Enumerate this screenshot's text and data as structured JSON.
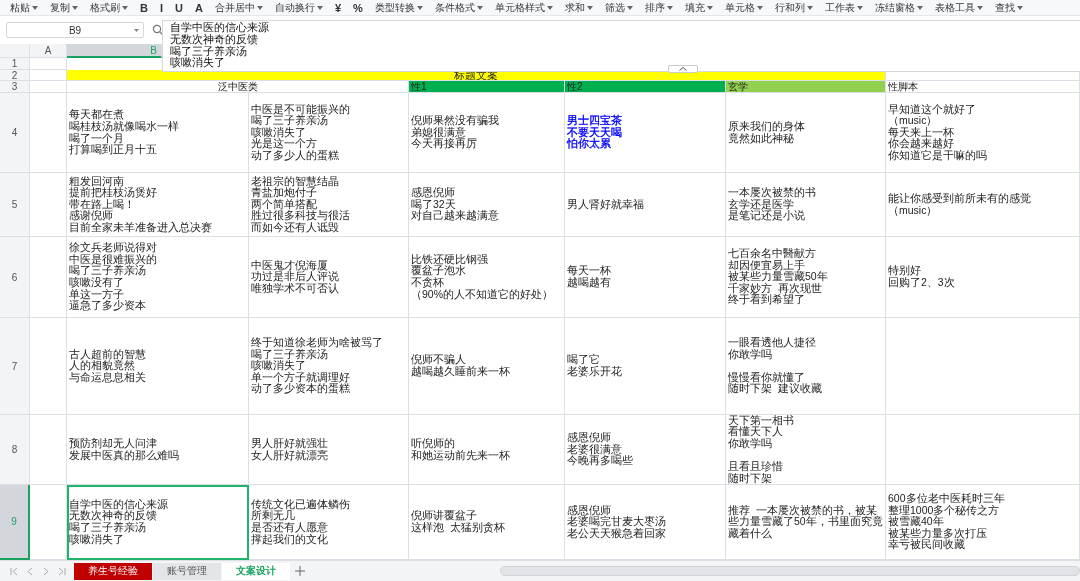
{
  "toolbar": {
    "items": [
      {
        "label": "粘贴",
        "kind": "text"
      },
      {
        "label": "复制",
        "kind": "text"
      },
      {
        "label": "格式刷",
        "kind": "text"
      },
      {
        "label": "B",
        "kind": "glyph"
      },
      {
        "label": "I",
        "kind": "glyph"
      },
      {
        "label": "U",
        "kind": "glyph"
      },
      {
        "label": "A",
        "kind": "glyph"
      },
      {
        "label": "合并居中",
        "kind": "text"
      },
      {
        "label": "自动换行",
        "kind": "text"
      },
      {
        "label": "¥",
        "kind": "glyph"
      },
      {
        "label": "%",
        "kind": "glyph"
      },
      {
        "label": "类型转换",
        "kind": "text"
      },
      {
        "label": "条件格式",
        "kind": "text"
      },
      {
        "label": "单元格样式",
        "kind": "text"
      },
      {
        "label": "求和",
        "kind": "text"
      },
      {
        "label": "筛选",
        "kind": "text"
      },
      {
        "label": "排序",
        "kind": "text"
      },
      {
        "label": "填充",
        "kind": "text"
      },
      {
        "label": "单元格",
        "kind": "text"
      },
      {
        "label": "行和列",
        "kind": "text"
      },
      {
        "label": "工作表",
        "kind": "text"
      },
      {
        "label": "冻结窗格",
        "kind": "text"
      },
      {
        "label": "表格工具",
        "kind": "text"
      },
      {
        "label": "查找",
        "kind": "text"
      }
    ]
  },
  "formula_bar": {
    "cell_ref": "B9",
    "lines": [
      "自学中医的信心来源",
      "无数次神奇的反馈",
      "喝了三子养亲汤",
      "咳嗽消失了"
    ]
  },
  "column_headers": [
    {
      "label": "A",
      "selected": false
    },
    {
      "label": "B",
      "selected": true
    }
  ],
  "blank_row": {
    "number": "1"
  },
  "title_row": {
    "number": "2",
    "text": "标题文案"
  },
  "header_row": {
    "number": "3",
    "cells": [
      {
        "text": "泛中医类",
        "color": "#ffffff"
      },
      {
        "text": "性1",
        "color": "#00b050"
      },
      {
        "text": "性2",
        "color": "#00b050"
      },
      {
        "text": "玄学",
        "color": "#92d050"
      },
      {
        "text": "性脚本",
        "color": "#ffffff"
      }
    ]
  },
  "rows": [
    {
      "number": "4",
      "selected": false,
      "cells": [
        {
          "groups": [
            [
              "每天都在煮",
              "喝桂枝汤就像喝水一样",
              "喝了一个月",
              "打算喝到正月十五"
            ]
          ],
          "selected": false
        },
        {
          "groups": [
            [
              "中医是不可能振兴的",
              "喝了三子养亲汤",
              "咳嗽消失了",
              "光是这一个方",
              "动了多少人的蛋糕"
            ]
          ],
          "selected": false
        },
        {
          "groups": [
            [
              "倪师果然没有骗我",
              "弟媳很满意",
              "今天再接再厉"
            ]
          ],
          "selected": false
        },
        {
          "groups": [
            [
              "男士四宝茶",
              "不要天天喝",
              "怕你太累"
            ]
          ],
          "selected": false,
          "color": "#0000ff"
        },
        {
          "groups": [
            [
              "原来我们的身体",
              "竟然如此神秘"
            ]
          ],
          "selected": false
        },
        {
          "groups": [
            [
              "早知道这个就好了",
              "（music）",
              "每天来上一杯",
              "你会越来越好",
              "你知道它是干嘛的吗"
            ]
          ],
          "selected": false
        }
      ]
    },
    {
      "number": "5",
      "selected": false,
      "cells": [
        {
          "groups": [
            [
              "粗发回河南",
              "提前把桂枝汤煲好",
              "带在路上喝！",
              "感谢倪师",
              "目前全家未羊准备进入总决赛"
            ]
          ],
          "selected": false
        },
        {
          "groups": [
            [
              "老祖宗的智慧结晶",
              "青盐加炮付子",
              "两个简单搭配",
              "胜过很多科技与很活",
              "而如今还有人诋毁"
            ]
          ],
          "selected": false
        },
        {
          "groups": [
            [
              "感恩倪师",
              "喝了32天",
              "对自己越来越满意"
            ]
          ],
          "selected": false
        },
        {
          "groups": [
            [
              "男人肾好就幸福"
            ]
          ],
          "selected": false
        },
        {
          "groups": [
            [
              "一本屡次被禁的书",
              "玄学还是医学",
              "是笔记还是小说"
            ]
          ],
          "selected": false
        },
        {
          "groups": [
            [
              "能让你感受到前所未有的感觉",
              "（music）"
            ]
          ],
          "selected": false
        }
      ]
    },
    {
      "number": "6",
      "selected": false,
      "cells": [
        {
          "groups": [
            [
              "徐文兵老师说得对",
              "中医是很难振兴的",
              "喝了三子养亲汤",
              "咳嗽没有了",
              "单这一方子",
              "逼急了多少资本"
            ]
          ],
          "selected": false
        },
        {
          "groups": [
            [
              "中医鬼才倪海厦",
              "功过是非后人评说",
              "唯独学术不可否认"
            ]
          ],
          "selected": false
        },
        {
          "groups": [
            [
              "比铁还硬比钢强",
              "覆盆子泡水",
              "不贪杯",
              "（90%的人不知道它的好处）"
            ]
          ],
          "selected": false
        },
        {
          "groups": [
            [
              "每天一杯",
              "越喝越有"
            ]
          ],
          "selected": false
        },
        {
          "groups": [
            [
              "七百余名中醫献方",
              "却因便宜易上手",
              "被某些力量雪藏50年",
              "千家妙方  再次现世",
              "终于看到希望了"
            ]
          ],
          "selected": false
        },
        {
          "groups": [
            [
              "特别好",
              "回购了2、3次"
            ]
          ],
          "selected": false
        }
      ]
    },
    {
      "number": "7",
      "selected": false,
      "cells": [
        {
          "groups": [
            [
              "古人超前的智慧",
              "人的相貌竟然",
              "与命运息息相关"
            ]
          ],
          "selected": false
        },
        {
          "groups": [
            [
              "终于知道徐老师为啥被骂了",
              "喝了三子养亲汤",
              "咳嗽消失了",
              "单一个方子就调理好",
              "动了多少资本的蛋糕"
            ]
          ],
          "selected": false
        },
        {
          "groups": [
            [
              "倪师不骗人",
              "越喝越久睡前来一杯"
            ]
          ],
          "selected": false
        },
        {
          "groups": [
            [
              "喝了它",
              "老婆乐开花"
            ]
          ],
          "selected": false
        },
        {
          "groups": [
            [
              "一眼看透他人捷径",
              "你敢学吗"
            ],
            [
              "慢慢看你就懂了",
              "随时下架  建议收藏"
            ]
          ],
          "selected": false
        },
        {
          "selected": false
        }
      ]
    },
    {
      "number": "8",
      "selected": false,
      "cells": [
        {
          "groups": [
            [
              "预防剂却无人问津",
              "发展中医真的那么难吗"
            ]
          ],
          "selected": false
        },
        {
          "groups": [
            [
              "男人肝好就强壮",
              "女人肝好就漂亮"
            ]
          ],
          "selected": false
        },
        {
          "groups": [
            [
              "听倪师的",
              "和她运动前先来一杯"
            ]
          ],
          "selected": false
        },
        {
          "groups": [
            [
              "感恩倪师",
              "老婆很满意",
              "今晚再多喝些"
            ]
          ],
          "selected": false
        },
        {
          "groups": [
            [
              "天下第一相书",
              "看懂天下人",
              "你敢学吗"
            ],
            [
              "且看且珍惜",
              "随时下架"
            ]
          ],
          "selected": false
        },
        {
          "selected": false
        }
      ]
    },
    {
      "number": "9",
      "selected": true,
      "cells": [
        {
          "groups": [
            [
              "自学中医的信心来源",
              "无数次神奇的反馈",
              "喝了三子养亲汤",
              "咳嗽消失了"
            ]
          ],
          "selected": true
        },
        {
          "groups": [
            [
              "传统文化已遍体鳞伤",
              "所剩无几",
              "是否还有人愿意",
              "撑起我们的文化"
            ]
          ],
          "selected": false
        },
        {
          "groups": [
            [
              "倪师讲覆盆子",
              "这样泡  太猛别贪杯"
            ]
          ],
          "selected": false
        },
        {
          "groups": [
            [
              "感恩倪师",
              "老婆喝完甘麦大枣汤",
              "老公天天猴急着回家"
            ]
          ],
          "selected": false
        },
        {
          "groups": [
            [
              "推荐  一本屡次被禁的书，被某些力量雪藏了50年，书里面究竟藏着什么"
            ]
          ],
          "selected": false
        },
        {
          "groups": [
            [
              "600多位老中医耗时三年",
              "整理1000多个秘传之方",
              "被雪藏40年",
              "被某些力量多次打压",
              "幸亏被民间收藏"
            ]
          ],
          "selected": false
        }
      ]
    }
  ],
  "sheet_tabs": [
    {
      "label": "养生号经验",
      "color": "#c00000",
      "selected": false
    },
    {
      "label": "账号管理",
      "color": "#e3e5e8",
      "selected": false
    },
    {
      "label": "文案设计",
      "color": "#ffffff",
      "selected": true
    }
  ]
}
